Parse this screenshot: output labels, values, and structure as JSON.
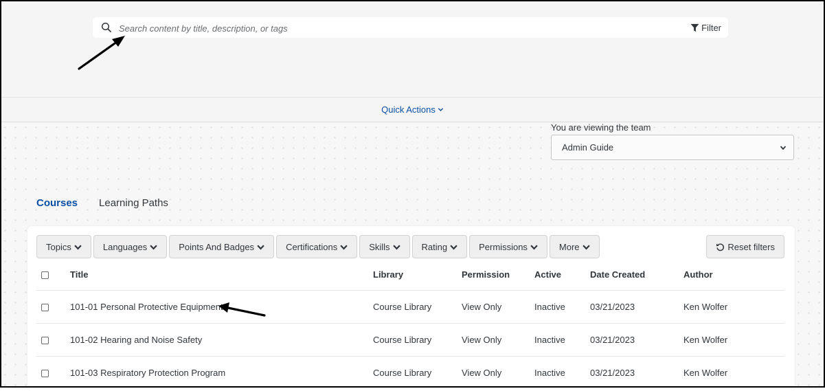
{
  "search": {
    "placeholder": "Search content by title, description, or tags",
    "filter_label": "Filter"
  },
  "quick_actions": {
    "label": "Quick Actions"
  },
  "team": {
    "label": "You are viewing the team",
    "selected": "Admin Guide"
  },
  "tabs": [
    {
      "label": "Courses",
      "active": true
    },
    {
      "label": "Learning Paths",
      "active": false
    }
  ],
  "filters": [
    {
      "label": "Topics"
    },
    {
      "label": "Languages"
    },
    {
      "label": "Points And Badges"
    },
    {
      "label": "Certifications"
    },
    {
      "label": "Skills"
    },
    {
      "label": "Rating"
    },
    {
      "label": "Permissions"
    },
    {
      "label": "More"
    }
  ],
  "reset_label": "Reset filters",
  "table": {
    "columns": [
      "Title",
      "Library",
      "Permission",
      "Active",
      "Date Created",
      "Author"
    ],
    "rows": [
      {
        "title": "101-01 Personal Protective Equipment",
        "library": "Course Library",
        "permission": "View Only",
        "active": "Inactive",
        "date": "03/21/2023",
        "author": "Ken Wolfer"
      },
      {
        "title": "101-02 Hearing and Noise Safety",
        "library": "Course Library",
        "permission": "View Only",
        "active": "Inactive",
        "date": "03/21/2023",
        "author": "Ken Wolfer"
      },
      {
        "title": "101-03 Respiratory Protection Program",
        "library": "Course Library",
        "permission": "View Only",
        "active": "Inactive",
        "date": "03/21/2023",
        "author": "Ken Wolfer"
      }
    ]
  },
  "colors": {
    "accent": "#0a4fa3",
    "header_bg": "#f5f5f5",
    "button_bg": "#efefef"
  }
}
